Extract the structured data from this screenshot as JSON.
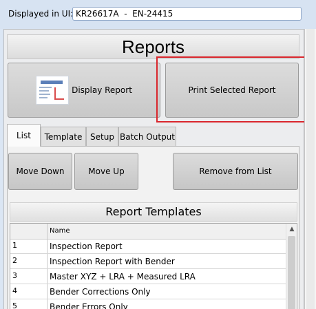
{
  "header": {
    "label": "Displayed in UI:",
    "value": "KR26617A  -  EN-24415"
  },
  "reports": {
    "title": "Reports",
    "display_button": "Display Report",
    "print_button": "Print Selected Report"
  },
  "tabs": [
    {
      "label": "List",
      "active": true
    },
    {
      "label": "Template",
      "active": false
    },
    {
      "label": "Setup",
      "active": false
    },
    {
      "label": "Batch Output",
      "active": false
    }
  ],
  "list_actions": {
    "move_down": "Move Down",
    "move_up": "Move Up",
    "remove": "Remove from List"
  },
  "templates": {
    "title": "Report Templates",
    "columns": [
      "",
      "Name"
    ],
    "rows": [
      {
        "index": "1",
        "name": "Inspection Report"
      },
      {
        "index": "2",
        "name": "Inspection Report with Bender"
      },
      {
        "index": "3",
        "name": "Master XYZ + LRA + Measured LRA"
      },
      {
        "index": "4",
        "name": "Bender Corrections Only"
      },
      {
        "index": "5",
        "name": "Bender Errors Only"
      }
    ]
  },
  "icons": {
    "display_report": "report-thumbnail-icon",
    "scroll_up": "chevron-up-icon"
  },
  "colors": {
    "highlight": "#d9262c"
  }
}
